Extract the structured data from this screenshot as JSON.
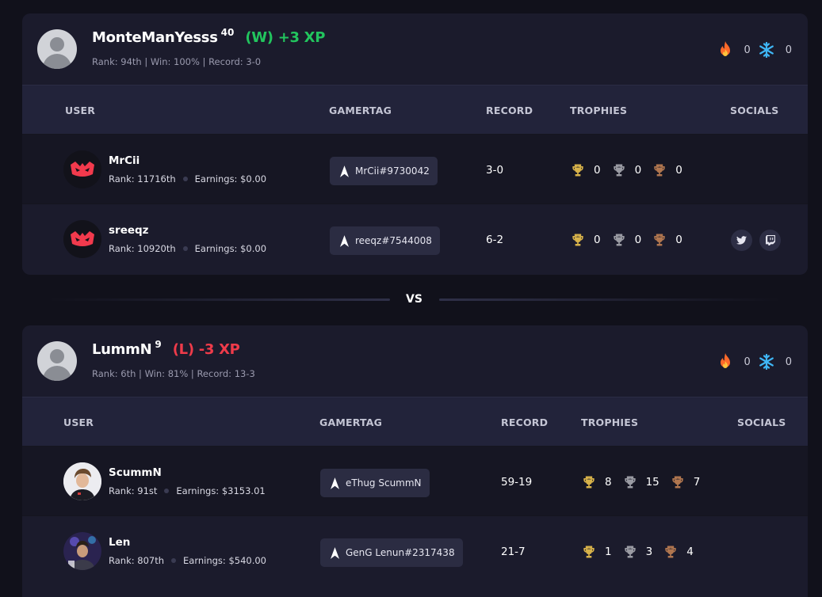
{
  "teams": [
    {
      "name": "MonteManYesss",
      "level": "40",
      "result": "(W) +3 XP",
      "stats": "Rank: 94th | Win: 100% | Record: 3-0",
      "fire_streak": "0",
      "ice_streak": "0",
      "headers": {
        "user": "USER",
        "gamertag": "GAMERTAG",
        "record": "RECORD",
        "trophies": "TROPHIES",
        "socials": "SOCIALS"
      },
      "players": [
        {
          "name": "MrCii",
          "rank": "Rank: 11716th",
          "earnings": "Earnings: $0.00",
          "gamertag": "MrCii#9730042",
          "record": "3-0",
          "gold": "0",
          "silver": "0",
          "bronze": "0"
        },
        {
          "name": "sreeqz",
          "rank": "Rank: 10920th",
          "earnings": "Earnings: $0.00",
          "gamertag": "reeqz#7544008",
          "record": "6-2",
          "gold": "0",
          "silver": "0",
          "bronze": "0",
          "socials": [
            "twitter-icon",
            "twitch-icon"
          ]
        }
      ]
    },
    {
      "name": "LummN",
      "level": "9",
      "result": "(L) -3 XP",
      "stats": "Rank: 6th | Win: 81% | Record: 13-3",
      "fire_streak": "0",
      "ice_streak": "0",
      "headers": {
        "user": "USER",
        "gamertag": "GAMERTAG",
        "record": "RECORD",
        "trophies": "TROPHIES",
        "socials": "SOCIALS"
      },
      "players": [
        {
          "name": "ScummN",
          "rank": "Rank: 91st",
          "earnings": "Earnings: $3153.01",
          "gamertag": "eThug ScummN",
          "record": "59-19",
          "gold": "8",
          "silver": "15",
          "bronze": "7"
        },
        {
          "name": "Len",
          "rank": "Rank: 807th",
          "earnings": "Earnings: $540.00",
          "gamertag": "GenG Lenun#2317438",
          "record": "21-7",
          "gold": "1",
          "silver": "3",
          "bronze": "4"
        }
      ]
    }
  ],
  "vs_label": "VS",
  "colors": {
    "win": "#22c55e",
    "loss": "#ef3b4a",
    "gold": "#d7b24a",
    "silver": "#9a9ba3",
    "bronze": "#b0764f",
    "fire": "#ff6a2a",
    "ice": "#3fb6f5"
  }
}
